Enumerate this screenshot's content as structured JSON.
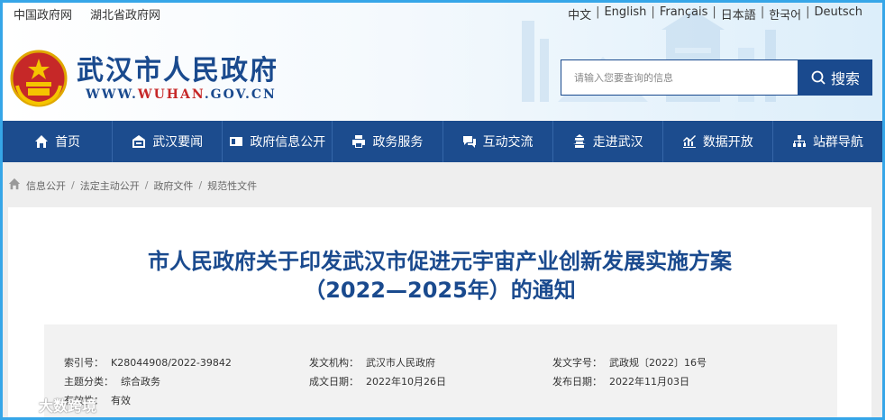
{
  "top_links": [
    "中国政府网",
    "湖北省政府网"
  ],
  "languages": [
    "中文",
    "English",
    "Français",
    "日本語",
    "한국어",
    "Deutsch"
  ],
  "site": {
    "name": "武汉市人民政府",
    "url_pre": "WWW.",
    "url_hl": "WUHAN",
    "url_post": ".GOV.CN"
  },
  "search": {
    "placeholder": "请输入您要查询的信息",
    "button": "搜索"
  },
  "nav": [
    {
      "label": "首页",
      "icon": "home-icon"
    },
    {
      "label": "武汉要闻",
      "icon": "news-icon"
    },
    {
      "label": "政府信息公开",
      "icon": "id-card-icon"
    },
    {
      "label": "政务服务",
      "icon": "printer-icon"
    },
    {
      "label": "互动交流",
      "icon": "chat-icon"
    },
    {
      "label": "走进武汉",
      "icon": "tower-icon"
    },
    {
      "label": "数据开放",
      "icon": "chart-icon"
    },
    {
      "label": "站群导航",
      "icon": "sitemap-icon"
    }
  ],
  "breadcrumb": [
    "信息公开",
    "法定主动公开",
    "政府文件",
    "规范性文件"
  ],
  "article": {
    "title_line1": "市人民政府关于印发武汉市促进元宇宙产业创新发展实施方案",
    "title_line2": "（2022—2025年）的通知"
  },
  "meta": {
    "index_label": "索引号：",
    "index_value": "K28044908/2022-39842",
    "issuer_label": "发文机构：",
    "issuer_value": "武汉市人民政府",
    "docno_label": "发文字号：",
    "docno_value": "武政规〔2022〕16号",
    "topic_label": "主题分类：",
    "topic_value": "综合政务",
    "created_label": "成文日期：",
    "created_value": "2022年10月26日",
    "published_label": "发布日期：",
    "published_value": "2022年11月03日",
    "validity_label": "有效性：",
    "validity_value": "有效"
  },
  "watermark": "大数跨境",
  "colors": {
    "brand": "#1a4a8e",
    "nav": "#1c4c8e",
    "frame": "#36a6e8",
    "accent_red": "#c62828"
  }
}
